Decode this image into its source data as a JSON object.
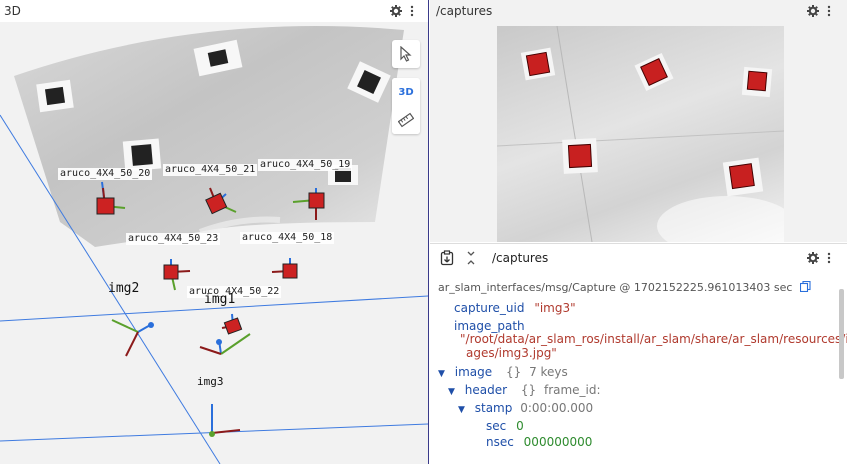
{
  "left_panel": {
    "title": "3D",
    "toolbar": {
      "mode_label": "3D"
    },
    "markers": [
      {
        "label": "aruco_4X4_50_20"
      },
      {
        "label": "aruco_4X4_50_21"
      },
      {
        "label": "aruco_4X4_50_19"
      },
      {
        "label": "aruco_4X4_50_23"
      },
      {
        "label": "aruco_4X4_50_18"
      },
      {
        "label": "aruco_4X4_50_22"
      }
    ],
    "cameras": [
      {
        "label": "img2"
      },
      {
        "label": "img1"
      },
      {
        "label": "img3"
      }
    ]
  },
  "image_panel": {
    "title": "/captures"
  },
  "message_panel": {
    "topic": "/captures",
    "meta": "ar_slam_interfaces/msg/Capture @ 1702152225.961013403 sec",
    "fields": {
      "capture_uid_key": "capture_uid",
      "capture_uid_val": "\"img3\"",
      "image_path_key": "image_path",
      "image_path_val_1": "\"/root/data/ar_slam_ros/install/ar_slam/share/ar_slam/resources/im",
      "image_path_val_2": "ages/img3.jpg\"",
      "image_key": "image",
      "image_type": "{}",
      "image_count": "7 keys",
      "header_key": "header",
      "header_type": "{}",
      "header_extra": "frame_id:",
      "stamp_key": "stamp",
      "stamp_val": "0:00:00.000",
      "sec_key": "sec",
      "sec_val": "0",
      "nsec_key": "nsec",
      "nsec_val": "000000000"
    }
  },
  "colors": {
    "x_axis": "#8b1a1a",
    "y_axis": "#5aa02c",
    "z_axis": "#2a6fdb",
    "marker_red": "#cc2222",
    "accent": "#2a6fdb"
  }
}
